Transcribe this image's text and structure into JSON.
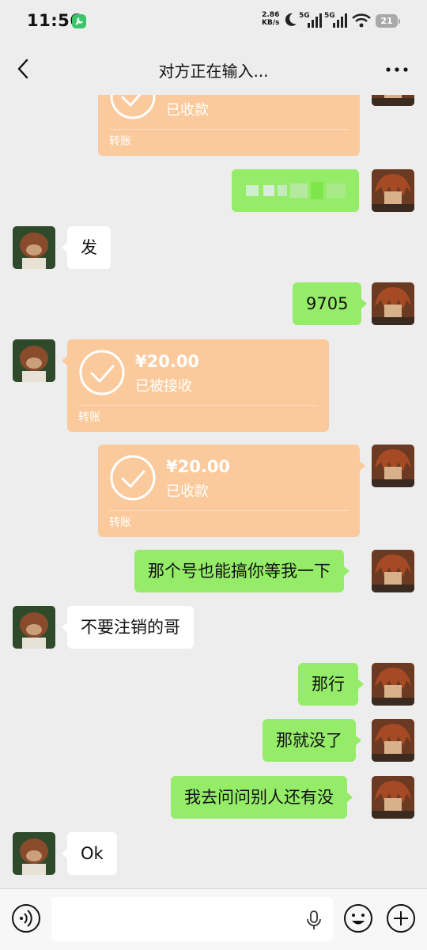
{
  "status_bar": {
    "time": "11:56",
    "net_speed_value": "2.86",
    "net_speed_unit": "KB/s",
    "signal1_label": "5G",
    "signal2_label": "5G",
    "battery": "21"
  },
  "header": {
    "title": "对方正在输入..."
  },
  "messages": [
    {
      "id": "t1",
      "side": "sent",
      "kind": "transfer",
      "status": "已收款",
      "label": "转账"
    },
    {
      "id": "m1",
      "side": "sent",
      "kind": "text",
      "text": ""
    },
    {
      "id": "m2",
      "side": "recv",
      "kind": "text",
      "text": "发"
    },
    {
      "id": "m3",
      "side": "sent",
      "kind": "text",
      "text": "9705"
    },
    {
      "id": "t2",
      "side": "recv",
      "kind": "transfer",
      "amount": "¥20.00",
      "status": "已被接收",
      "label": "转账"
    },
    {
      "id": "t3",
      "side": "sent",
      "kind": "transfer",
      "amount": "¥20.00",
      "status": "已收款",
      "label": "转账"
    },
    {
      "id": "m4",
      "side": "sent",
      "kind": "text",
      "text": "那个号也能搞你等我一下"
    },
    {
      "id": "m5",
      "side": "recv",
      "kind": "text",
      "text": "不要注销的哥"
    },
    {
      "id": "m6",
      "side": "sent",
      "kind": "text",
      "text": "那行"
    },
    {
      "id": "m7",
      "side": "sent",
      "kind": "text",
      "text": "那就没了"
    },
    {
      "id": "m8",
      "side": "sent",
      "kind": "text",
      "text": "我去问问别人还有没"
    },
    {
      "id": "m9",
      "side": "recv",
      "kind": "text",
      "text": "Ok"
    }
  ],
  "input": {
    "placeholder": ""
  },
  "colors": {
    "sent_bubble": "#95ec69",
    "recv_bubble": "#ffffff",
    "transfer": "#fbca9c",
    "background": "#ededed"
  }
}
